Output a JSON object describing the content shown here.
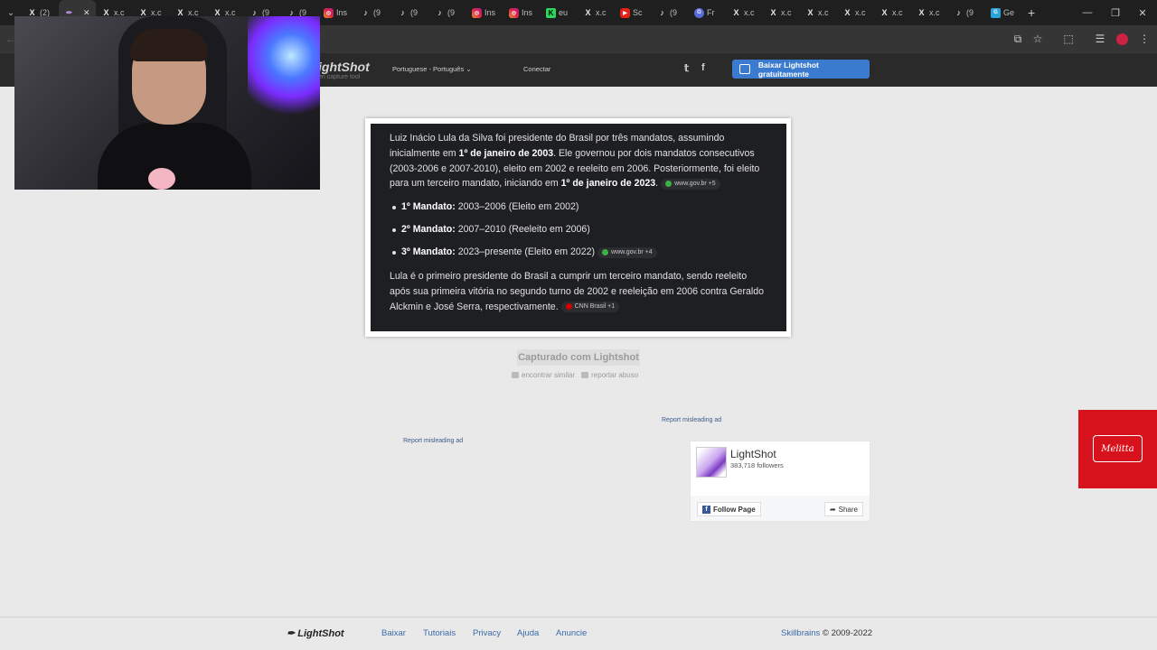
{
  "browser": {
    "tabs": [
      {
        "icon": "x-icon",
        "glyph": "X",
        "label": "(2)"
      },
      {
        "icon": "lightshot-icon",
        "glyph": "✒",
        "label": "",
        "active": true
      },
      {
        "icon": "x-icon",
        "glyph": "X",
        "label": "x.c"
      },
      {
        "icon": "x-icon",
        "glyph": "X",
        "label": "x.c"
      },
      {
        "icon": "x-icon",
        "glyph": "X",
        "label": "x.c"
      },
      {
        "icon": "x-icon",
        "glyph": "X",
        "label": "x.c"
      },
      {
        "icon": "tiktok-icon",
        "glyph": "♪",
        "label": "(9"
      },
      {
        "icon": "tiktok-icon",
        "glyph": "♪",
        "label": "(9"
      },
      {
        "icon": "instagram-icon",
        "glyph": "◎",
        "label": "Ins"
      },
      {
        "icon": "tiktok-icon",
        "glyph": "♪",
        "label": "(9"
      },
      {
        "icon": "tiktok-icon",
        "glyph": "♪",
        "label": "(9"
      },
      {
        "icon": "tiktok-icon",
        "glyph": "♪",
        "label": "(9"
      },
      {
        "icon": "instagram-icon",
        "glyph": "◎",
        "label": "Ins"
      },
      {
        "icon": "instagram-icon",
        "glyph": "◎",
        "label": "Ins"
      },
      {
        "icon": "kick-icon",
        "glyph": "K",
        "label": "eu"
      },
      {
        "icon": "x-icon",
        "glyph": "X",
        "label": "x.c"
      },
      {
        "icon": "youtube-icon",
        "glyph": "▶",
        "label": "Sc"
      },
      {
        "icon": "tiktok-icon",
        "glyph": "♪",
        "label": "(9"
      },
      {
        "icon": "google-icon",
        "glyph": "G",
        "label": "Fr"
      },
      {
        "icon": "x-icon",
        "glyph": "X",
        "label": "x.c"
      },
      {
        "icon": "x-icon",
        "glyph": "X",
        "label": "x.c"
      },
      {
        "icon": "x-icon",
        "glyph": "X",
        "label": "x.c"
      },
      {
        "icon": "x-icon",
        "glyph": "X",
        "label": "x.c"
      },
      {
        "icon": "x-icon",
        "glyph": "X",
        "label": "x.c"
      },
      {
        "icon": "x-icon",
        "glyph": "X",
        "label": "x.c"
      },
      {
        "icon": "tiktok-icon",
        "glyph": "♪",
        "label": "(9"
      },
      {
        "icon": "generic-icon",
        "glyph": "G",
        "label": "Ge"
      }
    ]
  },
  "header": {
    "logo": "ightShot",
    "tagline": "en capture tool",
    "language": "Portuguese - Português",
    "connect": "Conectar",
    "download": "Baixar Lightshot gratuitamente"
  },
  "card": {
    "p1_a": "Luiz Inácio Lula da Silva foi presidente do Brasil por três mandatos, assumindo inicialmente em ",
    "p1_b": "1º de janeiro de 2003",
    "p1_c": ". Ele governou por dois mandatos consecutivos (2003-2006 e 2007-2010), eleito em 2002 e reeleito em 2006. Posteriormente, foi eleito para um terceiro mandato, iniciando em ",
    "p1_d": "1º de janeiro de 2023",
    "p1_e": ".",
    "chip1": "www.gov.br +5",
    "items": [
      {
        "bold": "1º Mandato:",
        "text": " 2003–2006 (Eleito em 2002)"
      },
      {
        "bold": "2º Mandato:",
        "text": " 2007–2010 (Reeleito em 2006)"
      },
      {
        "bold": "3º Mandato:",
        "text": " 2023–presente (Eleito em 2022)"
      }
    ],
    "chip2": "www.gov.br +4",
    "p2": "Lula é o primeiro presidente do Brasil a cumprir um terceiro mandato, sendo reeleito após sua primeira vitória no segundo turno de 2002 e reeleição em 2006 contra Geraldo Alckmin e José Serra, respectivamente.",
    "chip3": "CNN Brasil +1"
  },
  "captured": "Capturado com Lightshot",
  "find_similar": "encontrar similar",
  "report_abuse": "reportar abuso",
  "ads": {
    "report1": "Report misleading ad",
    "report2": "Report misleading ad",
    "red_ad_brand": "Melitta"
  },
  "fb": {
    "name": "LightShot",
    "followers": "383,718 followers",
    "follow": "Follow Page",
    "share": "Share"
  },
  "footer": {
    "logo": "LightShot",
    "links": [
      "Baixar",
      "Tutoriais",
      "Privacy",
      "Ajuda",
      "Anuncie"
    ],
    "company": "Skillbrains",
    "copyright": " © 2009-2022"
  },
  "colors": {
    "accent": "#3a7bd0",
    "card_bg": "#1e1f23",
    "red_ad": "#d8121c"
  }
}
